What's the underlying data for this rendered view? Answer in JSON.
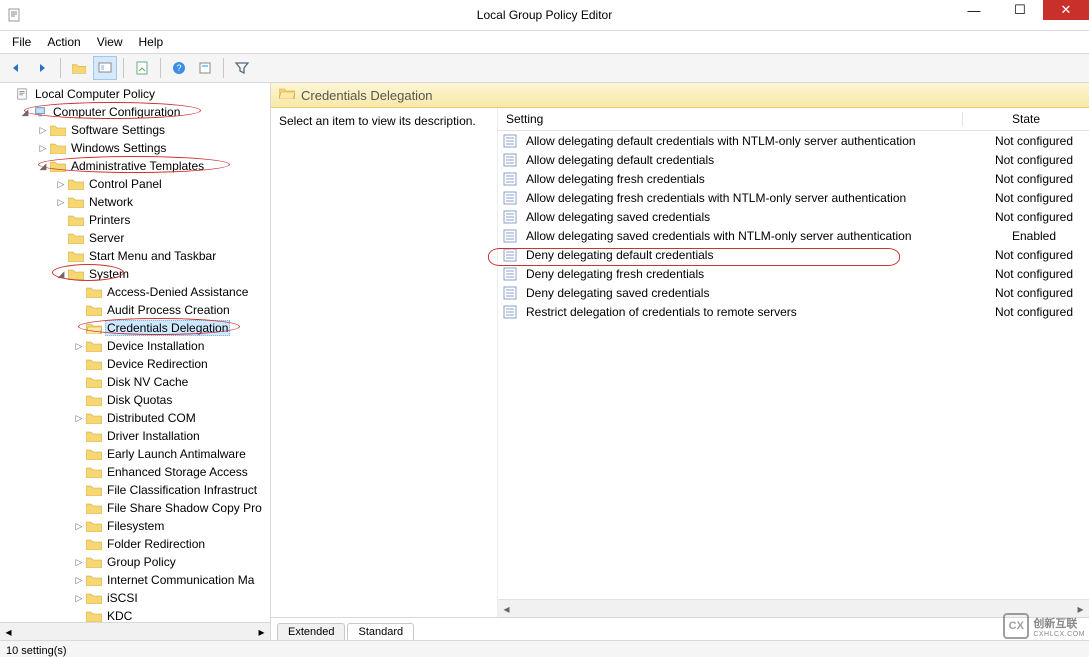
{
  "window": {
    "title": "Local Group Policy Editor"
  },
  "menu": {
    "file": "File",
    "action": "Action",
    "view": "View",
    "help": "Help"
  },
  "tree": {
    "root": "Local Computer Policy",
    "computer_config": "Computer Configuration",
    "software_settings": "Software Settings",
    "windows_settings": "Windows Settings",
    "admin_templates": "Administrative Templates",
    "control_panel": "Control Panel",
    "network": "Network",
    "printers": "Printers",
    "server": "Server",
    "start_menu": "Start Menu and Taskbar",
    "system": "System",
    "system_children": [
      "Access-Denied Assistance",
      "Audit Process Creation",
      "Credentials Delegation",
      "Device Installation",
      "Device Redirection",
      "Disk NV Cache",
      "Disk Quotas",
      "Distributed COM",
      "Driver Installation",
      "Early Launch Antimalware",
      "Enhanced Storage Access",
      "File Classification Infrastruct",
      "File Share Shadow Copy Pro",
      "Filesystem",
      "Folder Redirection",
      "Group Policy",
      "Internet Communication Ma",
      "iSCSI",
      "KDC"
    ],
    "selected_index": 2
  },
  "content": {
    "header": "Credentials Delegation",
    "desc_prompt": "Select an item to view its description.",
    "columns": {
      "setting": "Setting",
      "state": "State"
    },
    "rows": [
      {
        "name": "Allow delegating default credentials with NTLM-only server authentication",
        "state": "Not configured"
      },
      {
        "name": "Allow delegating default credentials",
        "state": "Not configured"
      },
      {
        "name": "Allow delegating fresh credentials",
        "state": "Not configured"
      },
      {
        "name": "Allow delegating fresh credentials with NTLM-only server authentication",
        "state": "Not configured"
      },
      {
        "name": "Allow delegating saved credentials",
        "state": "Not configured"
      },
      {
        "name": "Allow delegating saved credentials with NTLM-only server authentication",
        "state": "Enabled"
      },
      {
        "name": "Deny delegating default credentials",
        "state": "Not configured"
      },
      {
        "name": "Deny delegating fresh credentials",
        "state": "Not configured"
      },
      {
        "name": "Deny delegating saved credentials",
        "state": "Not configured"
      },
      {
        "name": "Restrict delegation of credentials to remote servers",
        "state": "Not configured"
      }
    ],
    "tabs": {
      "extended": "Extended",
      "standard": "Standard"
    }
  },
  "status": {
    "text": "10 setting(s)"
  },
  "watermark": {
    "brand": "创新互联",
    "sub": "CXHLCX.COM"
  }
}
